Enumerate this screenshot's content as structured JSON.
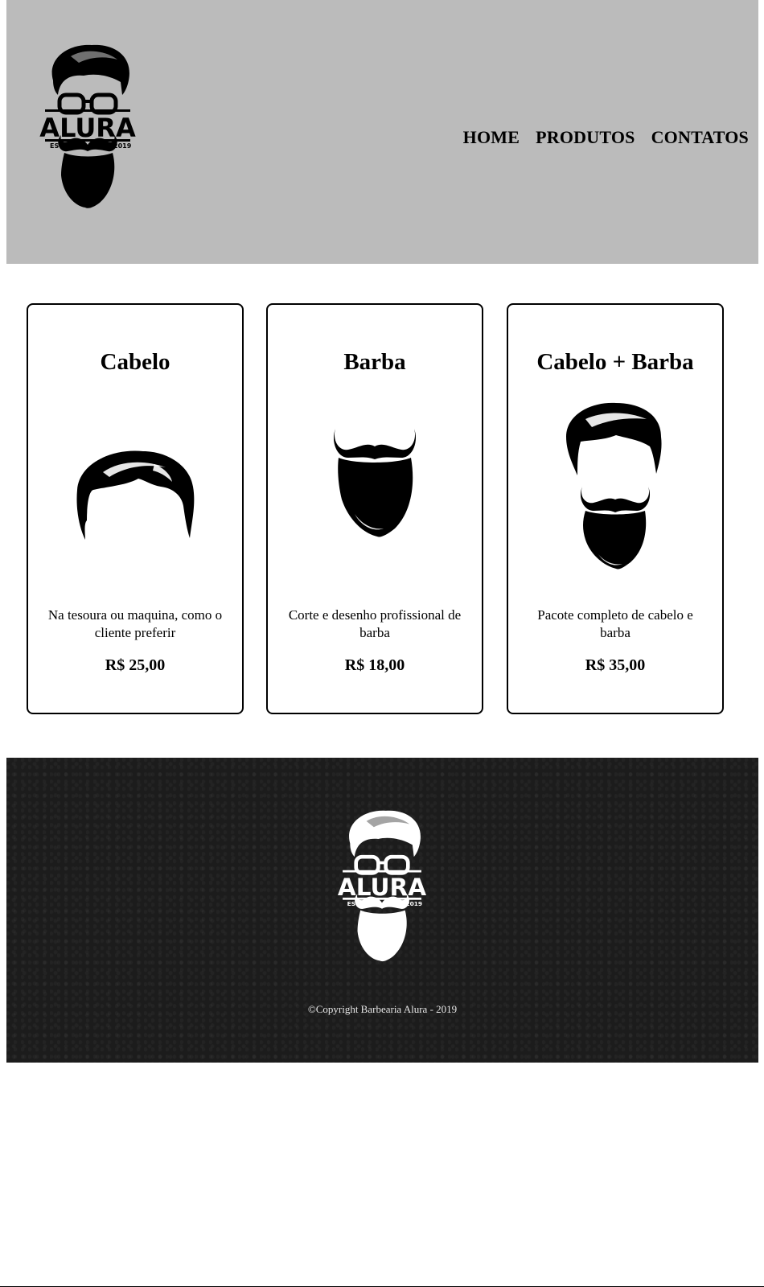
{
  "header": {
    "logo": {
      "wordmark": "ALURA",
      "left_text": "ESTD",
      "right_text": "2019",
      "icon": "bearded-man-logo-icon"
    },
    "nav": [
      {
        "label": "HOME"
      },
      {
        "label": "PRODUTOS"
      },
      {
        "label": "CONTATOS"
      }
    ]
  },
  "products": [
    {
      "title": "Cabelo",
      "icon": "hair-icon",
      "description": "Na tesoura ou maquina, como o cliente preferir",
      "price": "R$ 25,00"
    },
    {
      "title": "Barba",
      "icon": "beard-icon",
      "description": "Corte e desenho profissional de barba",
      "price": "R$ 18,00"
    },
    {
      "title": "Cabelo + Barba",
      "icon": "hair-and-beard-icon",
      "description": "Pacote completo de cabelo e barba",
      "price": "R$ 35,00"
    }
  ],
  "footer": {
    "logo": {
      "wordmark": "ALURA",
      "left_text": "ESTD",
      "right_text": "2019",
      "icon": "bearded-man-logo-icon"
    },
    "copyright": "©Copyright Barbearia Alura - 2019"
  },
  "colors": {
    "header_bg": "#bbbbbb",
    "footer_bg": "#1c1c1c",
    "text": "#000000",
    "footer_text": "#e8e8e8"
  }
}
